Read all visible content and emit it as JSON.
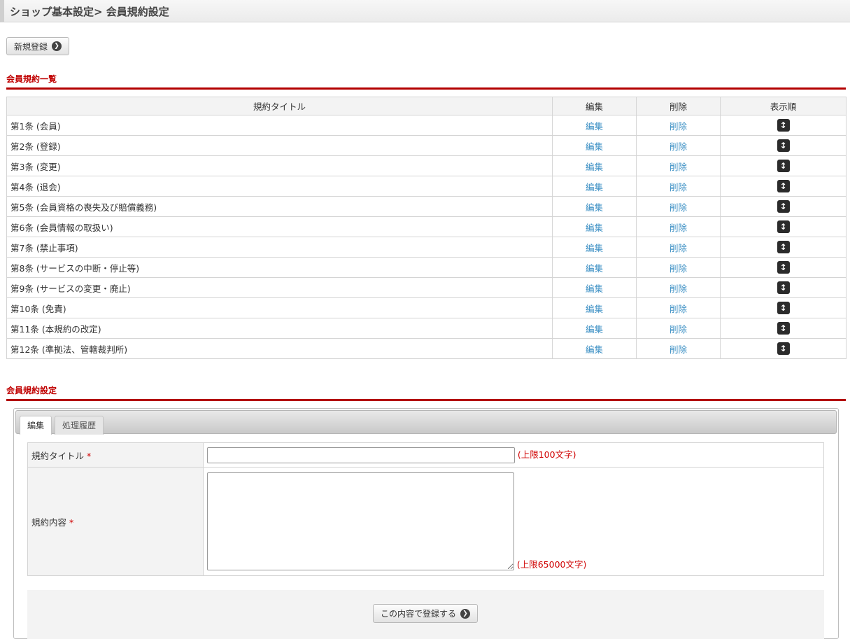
{
  "header": {
    "title": "ショップ基本設定> 会員規約設定"
  },
  "toolbar": {
    "new_label": "新規登録"
  },
  "list_section": {
    "title": "会員規約一覧",
    "columns": {
      "title": "規約タイトル",
      "edit": "編集",
      "delete": "削除",
      "order": "表示順"
    },
    "rows": [
      {
        "title": "第1条 (会員)",
        "edit": "編集",
        "delete": "削除"
      },
      {
        "title": "第2条 (登録)",
        "edit": "編集",
        "delete": "削除"
      },
      {
        "title": "第3条 (変更)",
        "edit": "編集",
        "delete": "削除"
      },
      {
        "title": "第4条 (退会)",
        "edit": "編集",
        "delete": "削除"
      },
      {
        "title": "第5条 (会員資格の喪失及び賠償義務)",
        "edit": "編集",
        "delete": "削除"
      },
      {
        "title": "第6条 (会員情報の取扱い)",
        "edit": "編集",
        "delete": "削除"
      },
      {
        "title": "第7条 (禁止事項)",
        "edit": "編集",
        "delete": "削除"
      },
      {
        "title": "第8条 (サービスの中断・停止等)",
        "edit": "編集",
        "delete": "削除"
      },
      {
        "title": "第9条 (サービスの変更・廃止)",
        "edit": "編集",
        "delete": "削除"
      },
      {
        "title": "第10条 (免責)",
        "edit": "編集",
        "delete": "削除"
      },
      {
        "title": "第11条 (本規約の改定)",
        "edit": "編集",
        "delete": "削除"
      },
      {
        "title": "第12条 (準拠法、管轄裁判所)",
        "edit": "編集",
        "delete": "削除"
      }
    ]
  },
  "form_section": {
    "title": "会員規約設定",
    "tabs": [
      {
        "label": "編集"
      },
      {
        "label": "処理履歴"
      }
    ],
    "fields": {
      "title_label": "規約タイトル",
      "title_required": "*",
      "title_value": "",
      "title_limit": "(上限100文字)",
      "body_label": "規約内容",
      "body_required": "*",
      "body_value": "",
      "body_limit": "(上限65000文字)"
    },
    "submit_label": "この内容で登録する"
  }
}
